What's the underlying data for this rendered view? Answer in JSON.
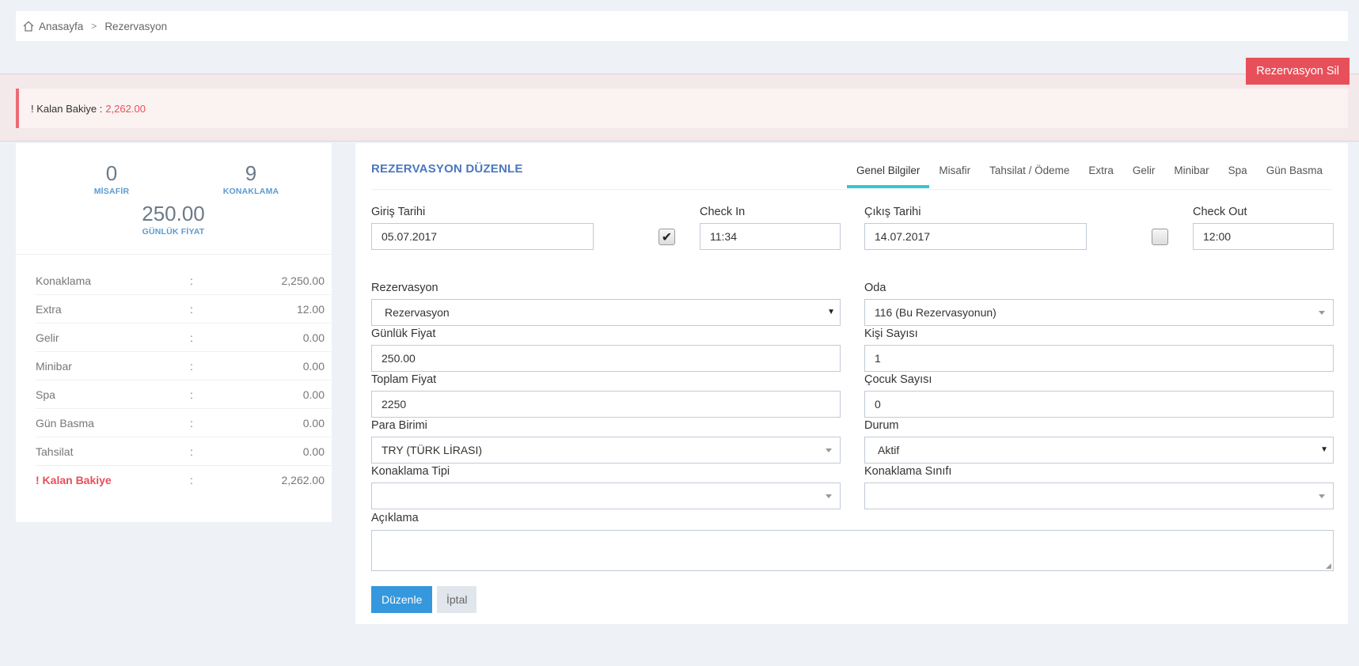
{
  "breadcrumb": {
    "home": "Anasayfa",
    "separator": ">",
    "current": "Rezervasyon"
  },
  "alert": {
    "label": "! Kalan Bakiye :",
    "amount": "2,262.00"
  },
  "actions": {
    "delete": "Rezervasyon Sil"
  },
  "stats": [
    {
      "value": "0",
      "label": "MİSAFİR"
    },
    {
      "value": "9",
      "label": "KONAKLAMA"
    },
    {
      "value": "250.00",
      "label": "GÜNLÜK FİYAT"
    }
  ],
  "summary": [
    {
      "key": "Konaklama",
      "value": "2,250.00"
    },
    {
      "key": "Extra",
      "value": "12.00"
    },
    {
      "key": "Gelir",
      "value": "0.00"
    },
    {
      "key": "Minibar",
      "value": "0.00"
    },
    {
      "key": "Spa",
      "value": "0.00"
    },
    {
      "key": "Gün Basma",
      "value": "0.00"
    },
    {
      "key": "Tahsilat",
      "value": "0.00"
    },
    {
      "key": "! Kalan Bakiye",
      "value": "2,262.00"
    }
  ],
  "summary_colon": ":",
  "main": {
    "title": "REZERVASYON DÜZENLE",
    "tabs": [
      "Genel Bilgiler",
      "Misafir",
      "Tahsilat / Ödeme",
      "Extra",
      "Gelir",
      "Minibar",
      "Spa",
      "Gün Basma"
    ]
  },
  "form": {
    "giris_tarihi": {
      "label": "Giriş Tarihi",
      "value": "05.07.2017"
    },
    "check_in": {
      "label": "Check In",
      "value": "11:34",
      "checked": true
    },
    "cikis_tarihi": {
      "label": "Çıkış Tarihi",
      "value": "14.07.2017"
    },
    "check_out": {
      "label": "Check Out",
      "value": "12:00",
      "checked": false
    },
    "rezervasyon": {
      "label": "Rezervasyon",
      "value": "Rezervasyon"
    },
    "oda": {
      "label": "Oda",
      "value": "116 (Bu Rezervasyonun)"
    },
    "gunluk_fiyat": {
      "label": "Günlük Fiyat",
      "value": "250.00"
    },
    "kisi_sayisi": {
      "label": "Kişi Sayısı",
      "value": "1"
    },
    "toplam_fiyat": {
      "label": "Toplam Fiyat",
      "value": "2250"
    },
    "cocuk_sayisi": {
      "label": "Çocuk Sayısı",
      "value": "0"
    },
    "para_birimi": {
      "label": "Para Birimi",
      "value": "TRY (TÜRK LİRASI)"
    },
    "durum": {
      "label": "Durum",
      "value": "Aktif"
    },
    "konaklama_tipi": {
      "label": "Konaklama Tipi",
      "value": ""
    },
    "konaklama_sinifi": {
      "label": "Konaklama Sınıfı",
      "value": ""
    },
    "aciklama": {
      "label": "Açıklama",
      "value": ""
    }
  },
  "buttons": {
    "submit": "Düzenle",
    "cancel": "İptal"
  },
  "colors": {
    "accent": "#3598dc",
    "danger": "#e7505a",
    "tab_active": "#36c6d3",
    "title": "#4b77be"
  }
}
